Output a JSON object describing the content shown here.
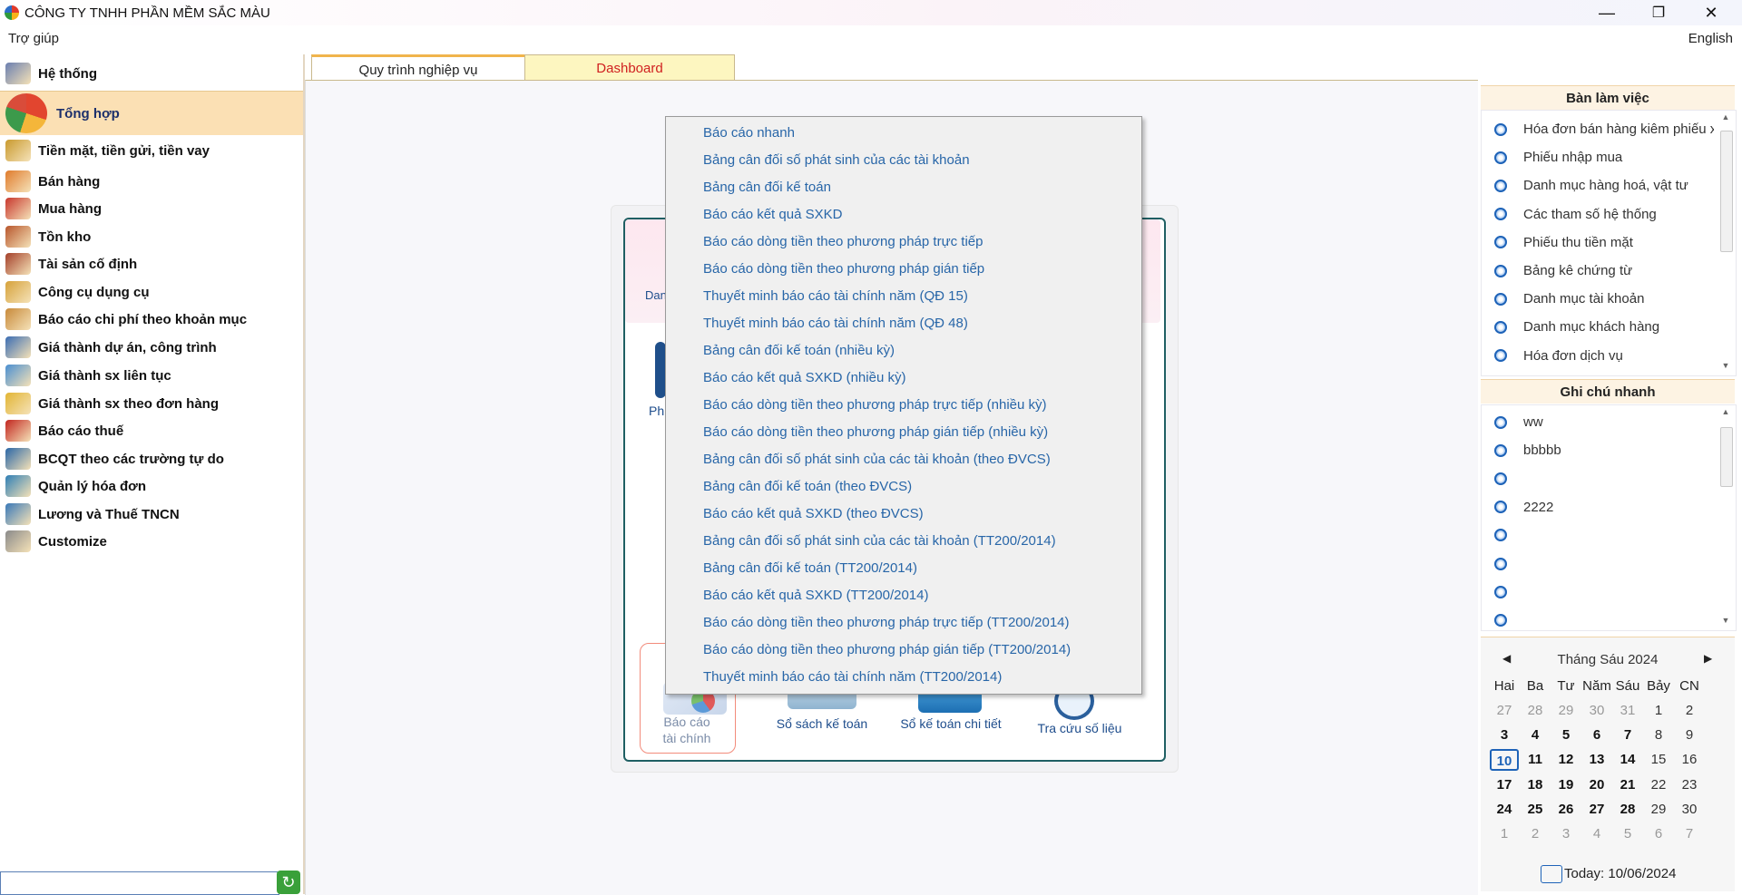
{
  "window": {
    "title": "CÔNG TY TNHH PHẦN MỀM SẮC MÀU",
    "minimize": "—",
    "restore": "❐",
    "close": "✕"
  },
  "menubar": {
    "help": "Trợ giúp",
    "language": "English"
  },
  "nav": {
    "items": [
      {
        "label": "Hệ thống",
        "icon": "system-icon",
        "color": "#6a7fb0"
      },
      {
        "label": "Tổng hợp",
        "icon": "summary-icon",
        "color": "#d94c3a",
        "active": true
      },
      {
        "label": "Tiền mặt, tiền gửi, tiền vay",
        "icon": "scale-icon",
        "color": "#c99a2e"
      },
      {
        "label": "Bán hàng",
        "icon": "sales-icon",
        "color": "#e07b2c"
      },
      {
        "label": "Mua hàng",
        "icon": "cart-icon",
        "color": "#c8372d"
      },
      {
        "label": "Tồn kho",
        "icon": "warehouse-icon",
        "color": "#b8562c"
      },
      {
        "label": "Tài sản cố định",
        "icon": "asset-icon",
        "color": "#a4402a"
      },
      {
        "label": "Công cụ dụng cụ",
        "icon": "tools-box-icon",
        "color": "#d6a23a"
      },
      {
        "label": "Báo cáo chi phí theo khoản mục",
        "icon": "cost-report-icon",
        "color": "#c88a3a"
      },
      {
        "label": "Giá thành dự án, công trình",
        "icon": "bar-chart-icon",
        "color": "#3b6db3"
      },
      {
        "label": "Giá thành sx liên tục",
        "icon": "dots-chart-icon",
        "color": "#4a8fd1"
      },
      {
        "label": "Giá thành sx theo đơn hàng",
        "icon": "folder-icon",
        "color": "#e2b534"
      },
      {
        "label": "Báo cáo thuế",
        "icon": "tax-icon",
        "color": "#c2261f"
      },
      {
        "label": "BCQT theo các trường tự do",
        "icon": "book-icon",
        "color": "#2a66a6"
      },
      {
        "label": "Quản lý hóa đơn",
        "icon": "invoice-icon",
        "color": "#2f7fb5"
      },
      {
        "label": "Lương và Thuế TNCN",
        "icon": "salary-icon",
        "color": "#3a79b8"
      },
      {
        "label": "Customize",
        "icon": "wrench-icon",
        "color": "#8a8a8a"
      }
    ],
    "search_value": "",
    "refresh_icon": "↻"
  },
  "tabs": [
    {
      "label": "Quy trình nghiệp vụ",
      "active": true
    },
    {
      "label": "Dashboard",
      "active": false
    }
  ],
  "workflow": {
    "partial_top_text": "Dan",
    "partial_left_label": "Ph",
    "buttons": [
      {
        "label_line1": "Báo cáo",
        "label_line2": "tài chính"
      },
      {
        "label": "Sổ sách kế toán"
      },
      {
        "label": "Sổ kế toán chi tiết"
      },
      {
        "label": "Tra cứu số liệu"
      }
    ]
  },
  "popup_menu": {
    "items": [
      "Báo cáo nhanh",
      "Bảng cân đối số phát sinh của các tài khoản",
      "Bảng cân đối kế toán",
      "Báo cáo kết quả SXKD",
      "Báo cáo dòng tiền theo phương pháp trực tiếp",
      "Báo cáo dòng tiền theo phương pháp gián tiếp",
      "Thuyết minh báo cáo tài chính năm (QĐ 15)",
      "Thuyết minh báo cáo tài chính năm (QĐ 48)",
      "Bảng cân đối kế toán (nhiều kỳ)",
      "Báo cáo kết quả SXKD (nhiều kỳ)",
      "Báo cáo dòng tiền theo phương pháp trực tiếp (nhiều kỳ)",
      "Báo cáo dòng tiền theo phương pháp gián tiếp (nhiều kỳ)",
      "Bảng cân đối số phát sinh của các tài khoản (theo ĐVCS)",
      "Bảng cân đối kế toán (theo ĐVCS)",
      "Báo cáo kết quả SXKD (theo ĐVCS)",
      "Bảng cân đối số phát sinh của các tài khoản (TT200/2014)",
      "Bảng cân đối kế toán (TT200/2014)",
      "Báo cáo kết quả SXKD (TT200/2014)",
      "Báo cáo dòng tiền theo phương pháp trực tiếp (TT200/2014)",
      "Báo cáo dòng tiền theo phương pháp gián tiếp (TT200/2014)",
      "Thuyết minh báo cáo tài chính năm (TT200/2014)"
    ]
  },
  "workdesk": {
    "title": "Bàn làm việc",
    "items": [
      "Hóa đơn bán hàng kiêm phiếu x",
      "Phiếu nhập mua",
      "Danh mục hàng hoá, vật tư",
      "Các tham số hệ thống",
      "Phiếu thu tiền mặt",
      "Bảng kê chứng từ",
      "Danh mục tài khoản",
      "Danh mục khách hàng",
      "Hóa đơn dịch vụ"
    ]
  },
  "quick_notes": {
    "title": "Ghi chú nhanh",
    "items": [
      "ww",
      "bbbbb",
      "",
      "2222",
      "",
      "",
      "",
      ""
    ]
  },
  "calendar": {
    "month_label": "Tháng Sáu 2024",
    "prev": "◀",
    "next": "▶",
    "day_headers": [
      "Hai",
      "Ba",
      "Tư",
      "Năm",
      "Sáu",
      "Bảy",
      "CN"
    ],
    "weeks": [
      [
        {
          "d": "27",
          "t": "other"
        },
        {
          "d": "28",
          "t": "other"
        },
        {
          "d": "29",
          "t": "other"
        },
        {
          "d": "30",
          "t": "other"
        },
        {
          "d": "31",
          "t": "other"
        },
        {
          "d": "1",
          "t": "normal"
        },
        {
          "d": "2",
          "t": "normal"
        }
      ],
      [
        {
          "d": "3",
          "t": "bold"
        },
        {
          "d": "4",
          "t": "bold"
        },
        {
          "d": "5",
          "t": "bold"
        },
        {
          "d": "6",
          "t": "bold"
        },
        {
          "d": "7",
          "t": "bold"
        },
        {
          "d": "8",
          "t": "normal"
        },
        {
          "d": "9",
          "t": "normal"
        }
      ],
      [
        {
          "d": "10",
          "t": "today"
        },
        {
          "d": "11",
          "t": "bold"
        },
        {
          "d": "12",
          "t": "bold"
        },
        {
          "d": "13",
          "t": "bold"
        },
        {
          "d": "14",
          "t": "bold"
        },
        {
          "d": "15",
          "t": "normal"
        },
        {
          "d": "16",
          "t": "normal"
        }
      ],
      [
        {
          "d": "17",
          "t": "bold"
        },
        {
          "d": "18",
          "t": "bold"
        },
        {
          "d": "19",
          "t": "bold"
        },
        {
          "d": "20",
          "t": "bold"
        },
        {
          "d": "21",
          "t": "bold"
        },
        {
          "d": "22",
          "t": "normal"
        },
        {
          "d": "23",
          "t": "normal"
        }
      ],
      [
        {
          "d": "24",
          "t": "bold"
        },
        {
          "d": "25",
          "t": "bold"
        },
        {
          "d": "26",
          "t": "bold"
        },
        {
          "d": "27",
          "t": "bold"
        },
        {
          "d": "28",
          "t": "bold"
        },
        {
          "d": "29",
          "t": "normal"
        },
        {
          "d": "30",
          "t": "normal"
        }
      ],
      [
        {
          "d": "1",
          "t": "other"
        },
        {
          "d": "2",
          "t": "other"
        },
        {
          "d": "3",
          "t": "other"
        },
        {
          "d": "4",
          "t": "other"
        },
        {
          "d": "5",
          "t": "other"
        },
        {
          "d": "6",
          "t": "other"
        },
        {
          "d": "7",
          "t": "other"
        }
      ]
    ],
    "today_label": "Today: 10/06/2024"
  }
}
